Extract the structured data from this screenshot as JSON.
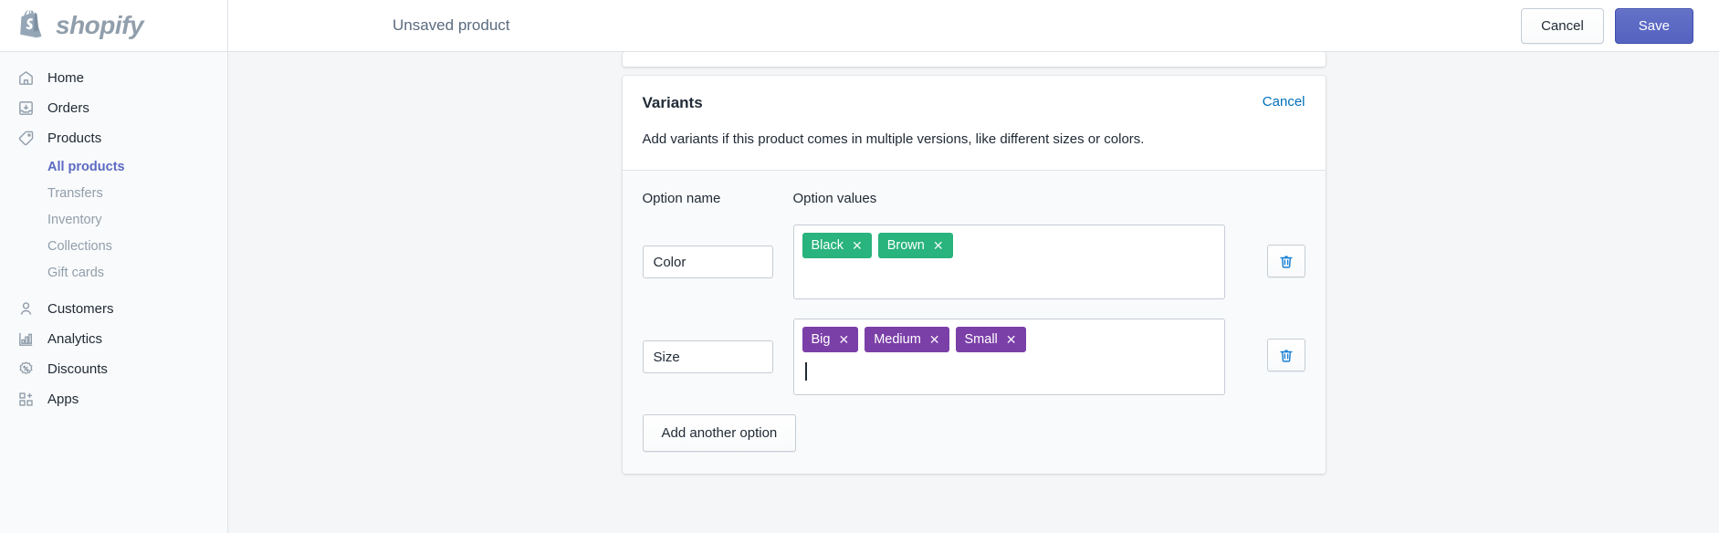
{
  "topbar": {
    "brand_name": "shopify",
    "brand_icon": "shopify-bag-icon",
    "page_title": "Unsaved product",
    "cancel_label": "Cancel",
    "save_label": "Save"
  },
  "sidebar": {
    "items": [
      {
        "label": "Home",
        "icon": "home-icon",
        "name": "home"
      },
      {
        "label": "Orders",
        "icon": "orders-inbox-icon",
        "name": "orders"
      },
      {
        "label": "Products",
        "icon": "products-tag-icon",
        "name": "products"
      },
      {
        "label": "Customers",
        "icon": "customers-person-icon",
        "name": "customers"
      },
      {
        "label": "Analytics",
        "icon": "analytics-bars-icon",
        "name": "analytics"
      },
      {
        "label": "Discounts",
        "icon": "discounts-percent-icon",
        "name": "discounts"
      },
      {
        "label": "Apps",
        "icon": "apps-grid-plus-icon",
        "name": "apps"
      }
    ],
    "sub_items": [
      {
        "label": "All products",
        "active": true
      },
      {
        "label": "Transfers",
        "active": false
      },
      {
        "label": "Inventory",
        "active": false
      },
      {
        "label": "Collections",
        "active": false
      },
      {
        "label": "Gift cards",
        "active": false
      }
    ]
  },
  "variants_card": {
    "title": "Variants",
    "cancel_label": "Cancel",
    "description": "Add variants if this product comes in multiple versions, like different sizes or colors.",
    "col_option_name": "Option name",
    "col_option_values": "Option values",
    "add_another_label": "Add another option",
    "delete_icon": "trash-icon",
    "options": [
      {
        "name_value": "Color",
        "name_placeholder": "",
        "tag_color": "#29b37d",
        "values": [
          "Black",
          "Brown"
        ],
        "has_caret": false
      },
      {
        "name_value": "Size",
        "name_placeholder": "",
        "tag_color": "#7b3fa8",
        "values": [
          "Big",
          "Medium",
          "Small"
        ],
        "has_caret": true
      }
    ]
  },
  "colors": {
    "accent_primary": "#5c6ac4",
    "link_blue": "#006fbb",
    "tag_green": "#29b37d",
    "tag_purple": "#7b3fa8",
    "trash_blue": "#1980d4",
    "page_bg": "#f4f6f8",
    "text_default": "#212b36",
    "text_muted": "#919eab"
  }
}
